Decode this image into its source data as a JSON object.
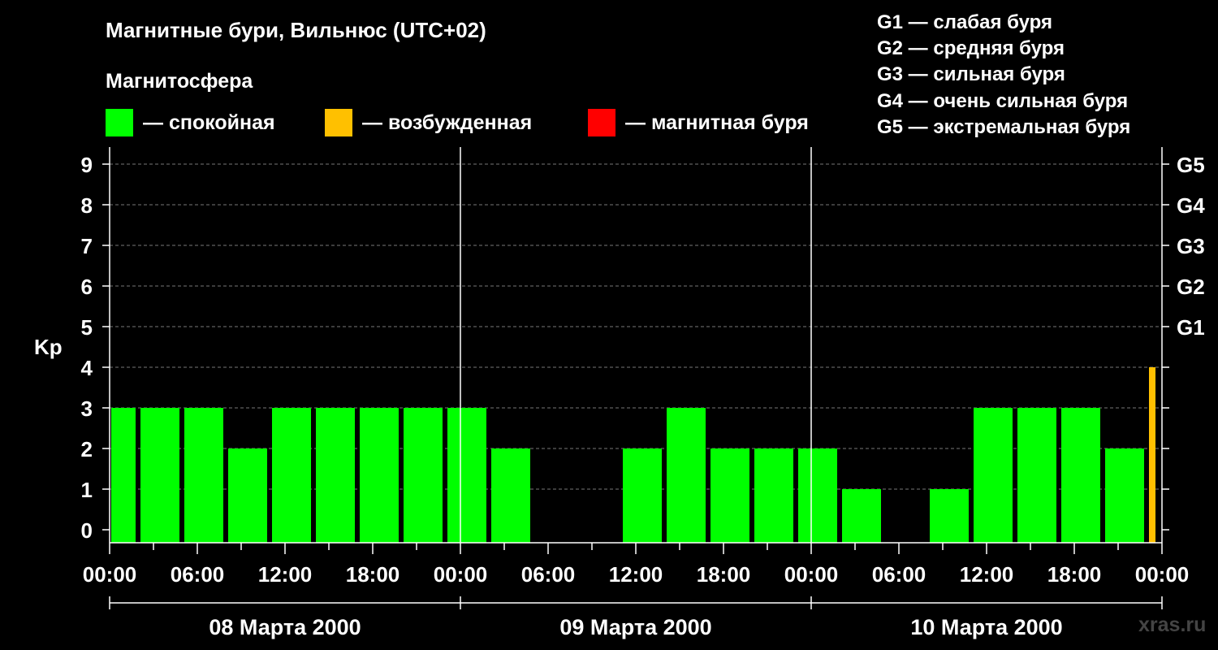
{
  "title": "Магнитные бури, Вильнюс (UTC+02)",
  "subtitle": "Магнитосфера",
  "legend": [
    {
      "label": "— спокойная",
      "color": "#00ff00"
    },
    {
      "label": "— возбужденная",
      "color": "#ffc000"
    },
    {
      "label": "— магнитная буря",
      "color": "#ff0000"
    }
  ],
  "g_scale": [
    "G1 — слабая буря",
    "G2 — средняя буря",
    "G3 — сильная буря",
    "G4 — очень сильная буря",
    "G5 — экстремальная буря"
  ],
  "watermark": "xras.ru",
  "chart_data": {
    "type": "bar",
    "ylabel": "Kp",
    "ylim": [
      0,
      9
    ],
    "yticks": [
      0,
      1,
      2,
      3,
      4,
      5,
      6,
      7,
      8,
      9
    ],
    "right_labels": [
      {
        "y": 5,
        "label": "G1"
      },
      {
        "y": 6,
        "label": "G2"
      },
      {
        "y": 7,
        "label": "G3"
      },
      {
        "y": 8,
        "label": "G4"
      },
      {
        "y": 9,
        "label": "G5"
      }
    ],
    "xrange_hours": [
      0,
      72
    ],
    "xtick_labels": [
      "00:00",
      "06:00",
      "12:00",
      "18:00",
      "00:00",
      "06:00",
      "12:00",
      "18:00",
      "00:00",
      "06:00",
      "12:00",
      "18:00",
      "00:00"
    ],
    "days": [
      "08 Марта 2000",
      "09 Марта 2000",
      "10 Марта 2000"
    ],
    "grid": "horizontal dashed",
    "bars": [
      {
        "start": 0,
        "end": 2,
        "value": 3,
        "color": "#00ff00"
      },
      {
        "start": 2,
        "end": 5,
        "value": 3,
        "color": "#00ff00"
      },
      {
        "start": 5,
        "end": 8,
        "value": 3,
        "color": "#00ff00"
      },
      {
        "start": 8,
        "end": 11,
        "value": 2,
        "color": "#00ff00"
      },
      {
        "start": 11,
        "end": 14,
        "value": 3,
        "color": "#00ff00"
      },
      {
        "start": 14,
        "end": 17,
        "value": 3,
        "color": "#00ff00"
      },
      {
        "start": 17,
        "end": 20,
        "value": 3,
        "color": "#00ff00"
      },
      {
        "start": 20,
        "end": 23,
        "value": 3,
        "color": "#00ff00"
      },
      {
        "start": 23,
        "end": 26,
        "value": 3,
        "color": "#00ff00"
      },
      {
        "start": 26,
        "end": 29,
        "value": 2,
        "color": "#00ff00"
      },
      {
        "start": 35,
        "end": 38,
        "value": 2,
        "color": "#00ff00"
      },
      {
        "start": 38,
        "end": 41,
        "value": 3,
        "color": "#00ff00"
      },
      {
        "start": 41,
        "end": 44,
        "value": 2,
        "color": "#00ff00"
      },
      {
        "start": 44,
        "end": 47,
        "value": 2,
        "color": "#00ff00"
      },
      {
        "start": 47,
        "end": 50,
        "value": 2,
        "color": "#00ff00"
      },
      {
        "start": 50,
        "end": 53,
        "value": 1,
        "color": "#00ff00"
      },
      {
        "start": 56,
        "end": 59,
        "value": 1,
        "color": "#00ff00"
      },
      {
        "start": 59,
        "end": 62,
        "value": 3,
        "color": "#00ff00"
      },
      {
        "start": 62,
        "end": 65,
        "value": 3,
        "color": "#00ff00"
      },
      {
        "start": 65,
        "end": 68,
        "value": 3,
        "color": "#00ff00"
      },
      {
        "start": 68,
        "end": 71,
        "value": 2,
        "color": "#00ff00"
      },
      {
        "start": 71,
        "end": 71.7,
        "value": 4,
        "color": "#ffc000"
      }
    ]
  }
}
